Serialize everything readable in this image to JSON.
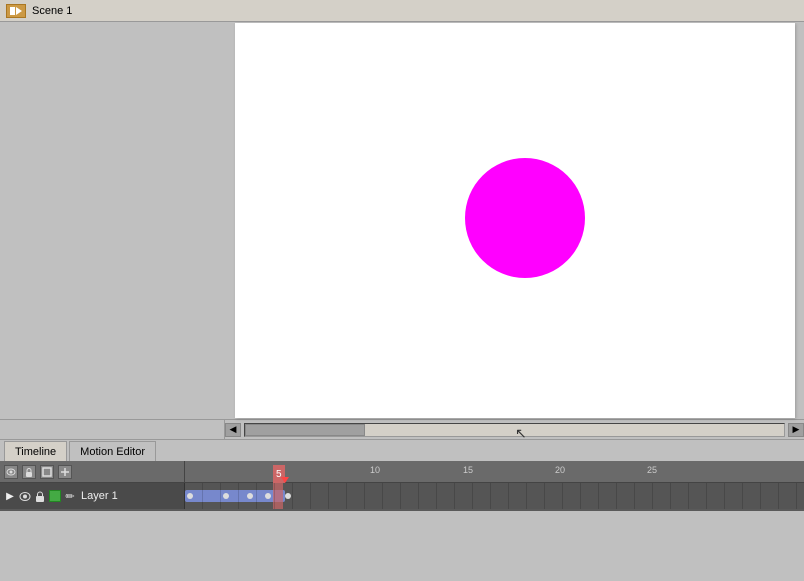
{
  "titleBar": {
    "title": "Scene 1"
  },
  "stage": {
    "backgroundColor": "#ffffff",
    "circle": {
      "color": "#ff00ff"
    }
  },
  "tabs": [
    {
      "id": "timeline",
      "label": "Timeline",
      "active": false
    },
    {
      "id": "motion-editor",
      "label": "Motion Editor",
      "active": true
    }
  ],
  "timeline": {
    "layers": [
      {
        "name": "Layer 1",
        "visible": true,
        "locked": false,
        "color": "#44aa44"
      }
    ],
    "rulerMarks": [
      {
        "frame": 10,
        "label": "10"
      },
      {
        "frame": 15,
        "label": "15"
      },
      {
        "frame": 20,
        "label": "20"
      },
      {
        "frame": 25,
        "label": "25"
      }
    ],
    "currentFrame": 5,
    "playheadColor": "#ff3333"
  },
  "icons": {
    "eye": "👁",
    "lock": "🔒",
    "pencil": "✏",
    "scene": "🎬"
  },
  "scrollbar": {
    "cursor": "↖"
  }
}
